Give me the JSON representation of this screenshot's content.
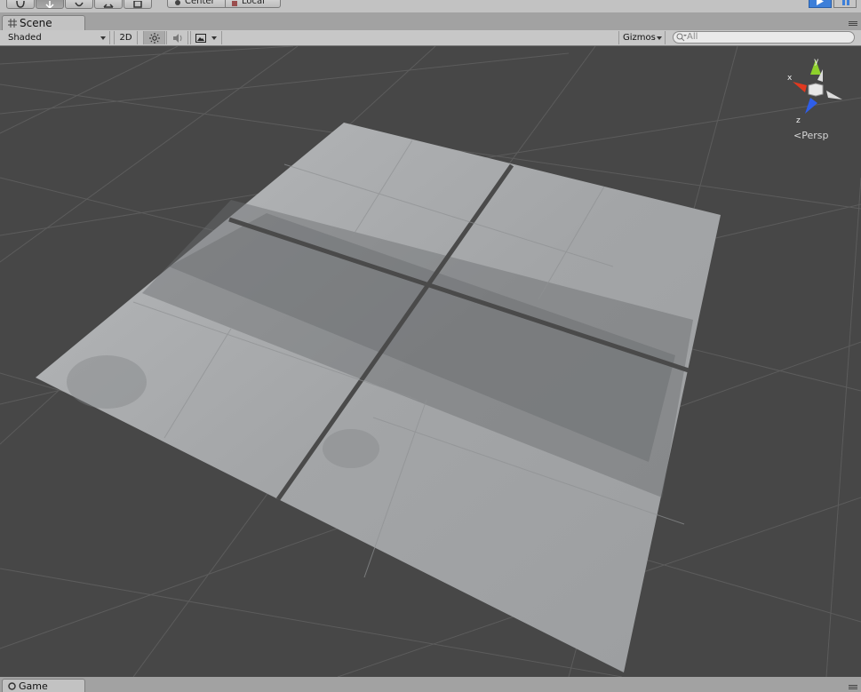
{
  "toolbar": {
    "tools": [
      "hand-tool",
      "move-tool",
      "rotate-tool",
      "scale-tool",
      "rect-tool"
    ],
    "active_tool": "move-tool",
    "pivot_mode": "Center",
    "pivot_rotation": "Local",
    "play_active": true
  },
  "scene_tab": {
    "label": "Scene",
    "icon": "grid-icon"
  },
  "scene_toolbar": {
    "shading_mode": "Shaded",
    "mode_2d": "2D",
    "gizmos": "Gizmos",
    "search_placeholder": "All"
  },
  "gizmo": {
    "axis_x": "x",
    "axis_y": "y",
    "axis_z": "z",
    "projection": "Persp",
    "colors": {
      "x": "#e0391f",
      "y": "#8ed02b",
      "z": "#2f5ee8"
    }
  },
  "game_tab": {
    "label": "Game"
  }
}
